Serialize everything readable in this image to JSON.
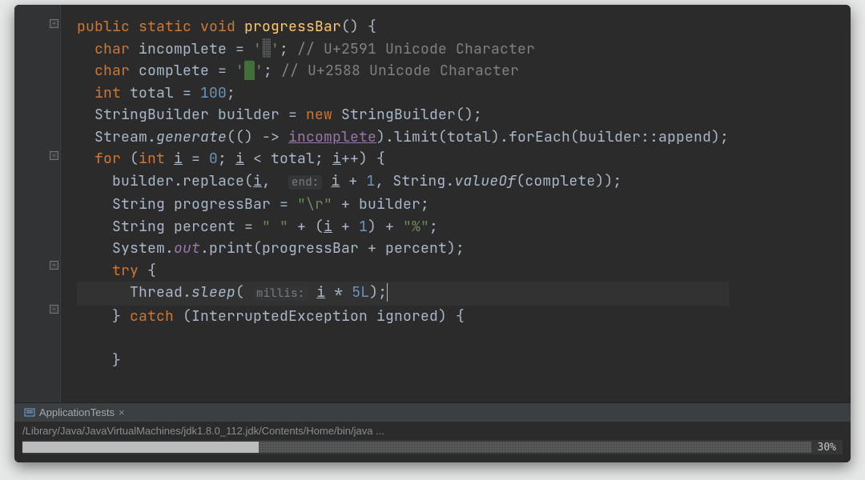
{
  "code": {
    "l1": {
      "public": "public",
      "static": "static",
      "void": "void",
      "fn": "progressBar",
      "paren": "() {"
    },
    "l2": {
      "char": "char",
      "name": "incomplete",
      "eq": " = ",
      "q1": "'",
      "glyph": "░",
      "q2": "'",
      "semi": ";",
      "cmt": "// U+2591 Unicode Character"
    },
    "l3": {
      "char": "char",
      "name": "complete",
      "eq": " = ",
      "q1": "'",
      "glyph": "█",
      "q2": "'",
      "semi": ";",
      "cmt": "// U+2588 Unicode Character"
    },
    "l4": {
      "int": "int",
      "name": "total",
      "eq": " = ",
      "val": "100",
      "semi": ";"
    },
    "l5": {
      "text": "StringBuilder builder = ",
      "new": "new",
      "ctor": " StringBuilder();"
    },
    "l6": {
      "a": "Stream.",
      "gen": "generate",
      "b": "(() -> ",
      "inc": "incomplete",
      "c": ").limit(total).forEach(builder::append);"
    },
    "l7": {
      "for": "for",
      "a": " (",
      "int": "int",
      "b": " ",
      "i": "i",
      "c": " = ",
      "z": "0",
      "d": "; ",
      "i2": "i",
      "lt": " < total; ",
      "i3": "i",
      "pp": "++",
      "e": ") {"
    },
    "l8": {
      "a": "builder.replace(",
      "i": "i",
      "b": ",  ",
      "hint": "end:",
      "sp": " ",
      "i2": "i",
      "c": " + ",
      "one": "1",
      "d": ", String.",
      "vo": "valueOf",
      "e": "(complete));"
    },
    "l9": {
      "a": "String progressBar = ",
      "s": "\"\\r\"",
      "b": " + builder;"
    },
    "l10": {
      "a": "String percent = ",
      "s1": "\" \"",
      "b": " + (",
      "i": "i",
      "c": " + ",
      "one": "1",
      "d": ") + ",
      "s2": "\"%\"",
      "e": ";"
    },
    "l11": {
      "a": "System.",
      "out": "out",
      "b": ".print(progressBar + percent);"
    },
    "l12": {
      "try": "try",
      "a": " {"
    },
    "l13": {
      "a": "Thread.",
      "sleep": "sleep",
      "b": "( ",
      "hint": "millis:",
      "sp": " ",
      "i": "i",
      "c": " * ",
      "five": "5L",
      "d": ");"
    },
    "l14": {
      "a": "} ",
      "catch": "catch",
      "b": " (InterruptedException ignored) {"
    },
    "l15": {
      "a": "}"
    }
  },
  "console": {
    "tab_label": "ApplicationTests",
    "path": "/Library/Java/JavaVirtualMachines/jdk1.8.0_112.jdk/Contents/Home/bin/java ...",
    "percent_label": "30%",
    "percent_value": 30
  }
}
